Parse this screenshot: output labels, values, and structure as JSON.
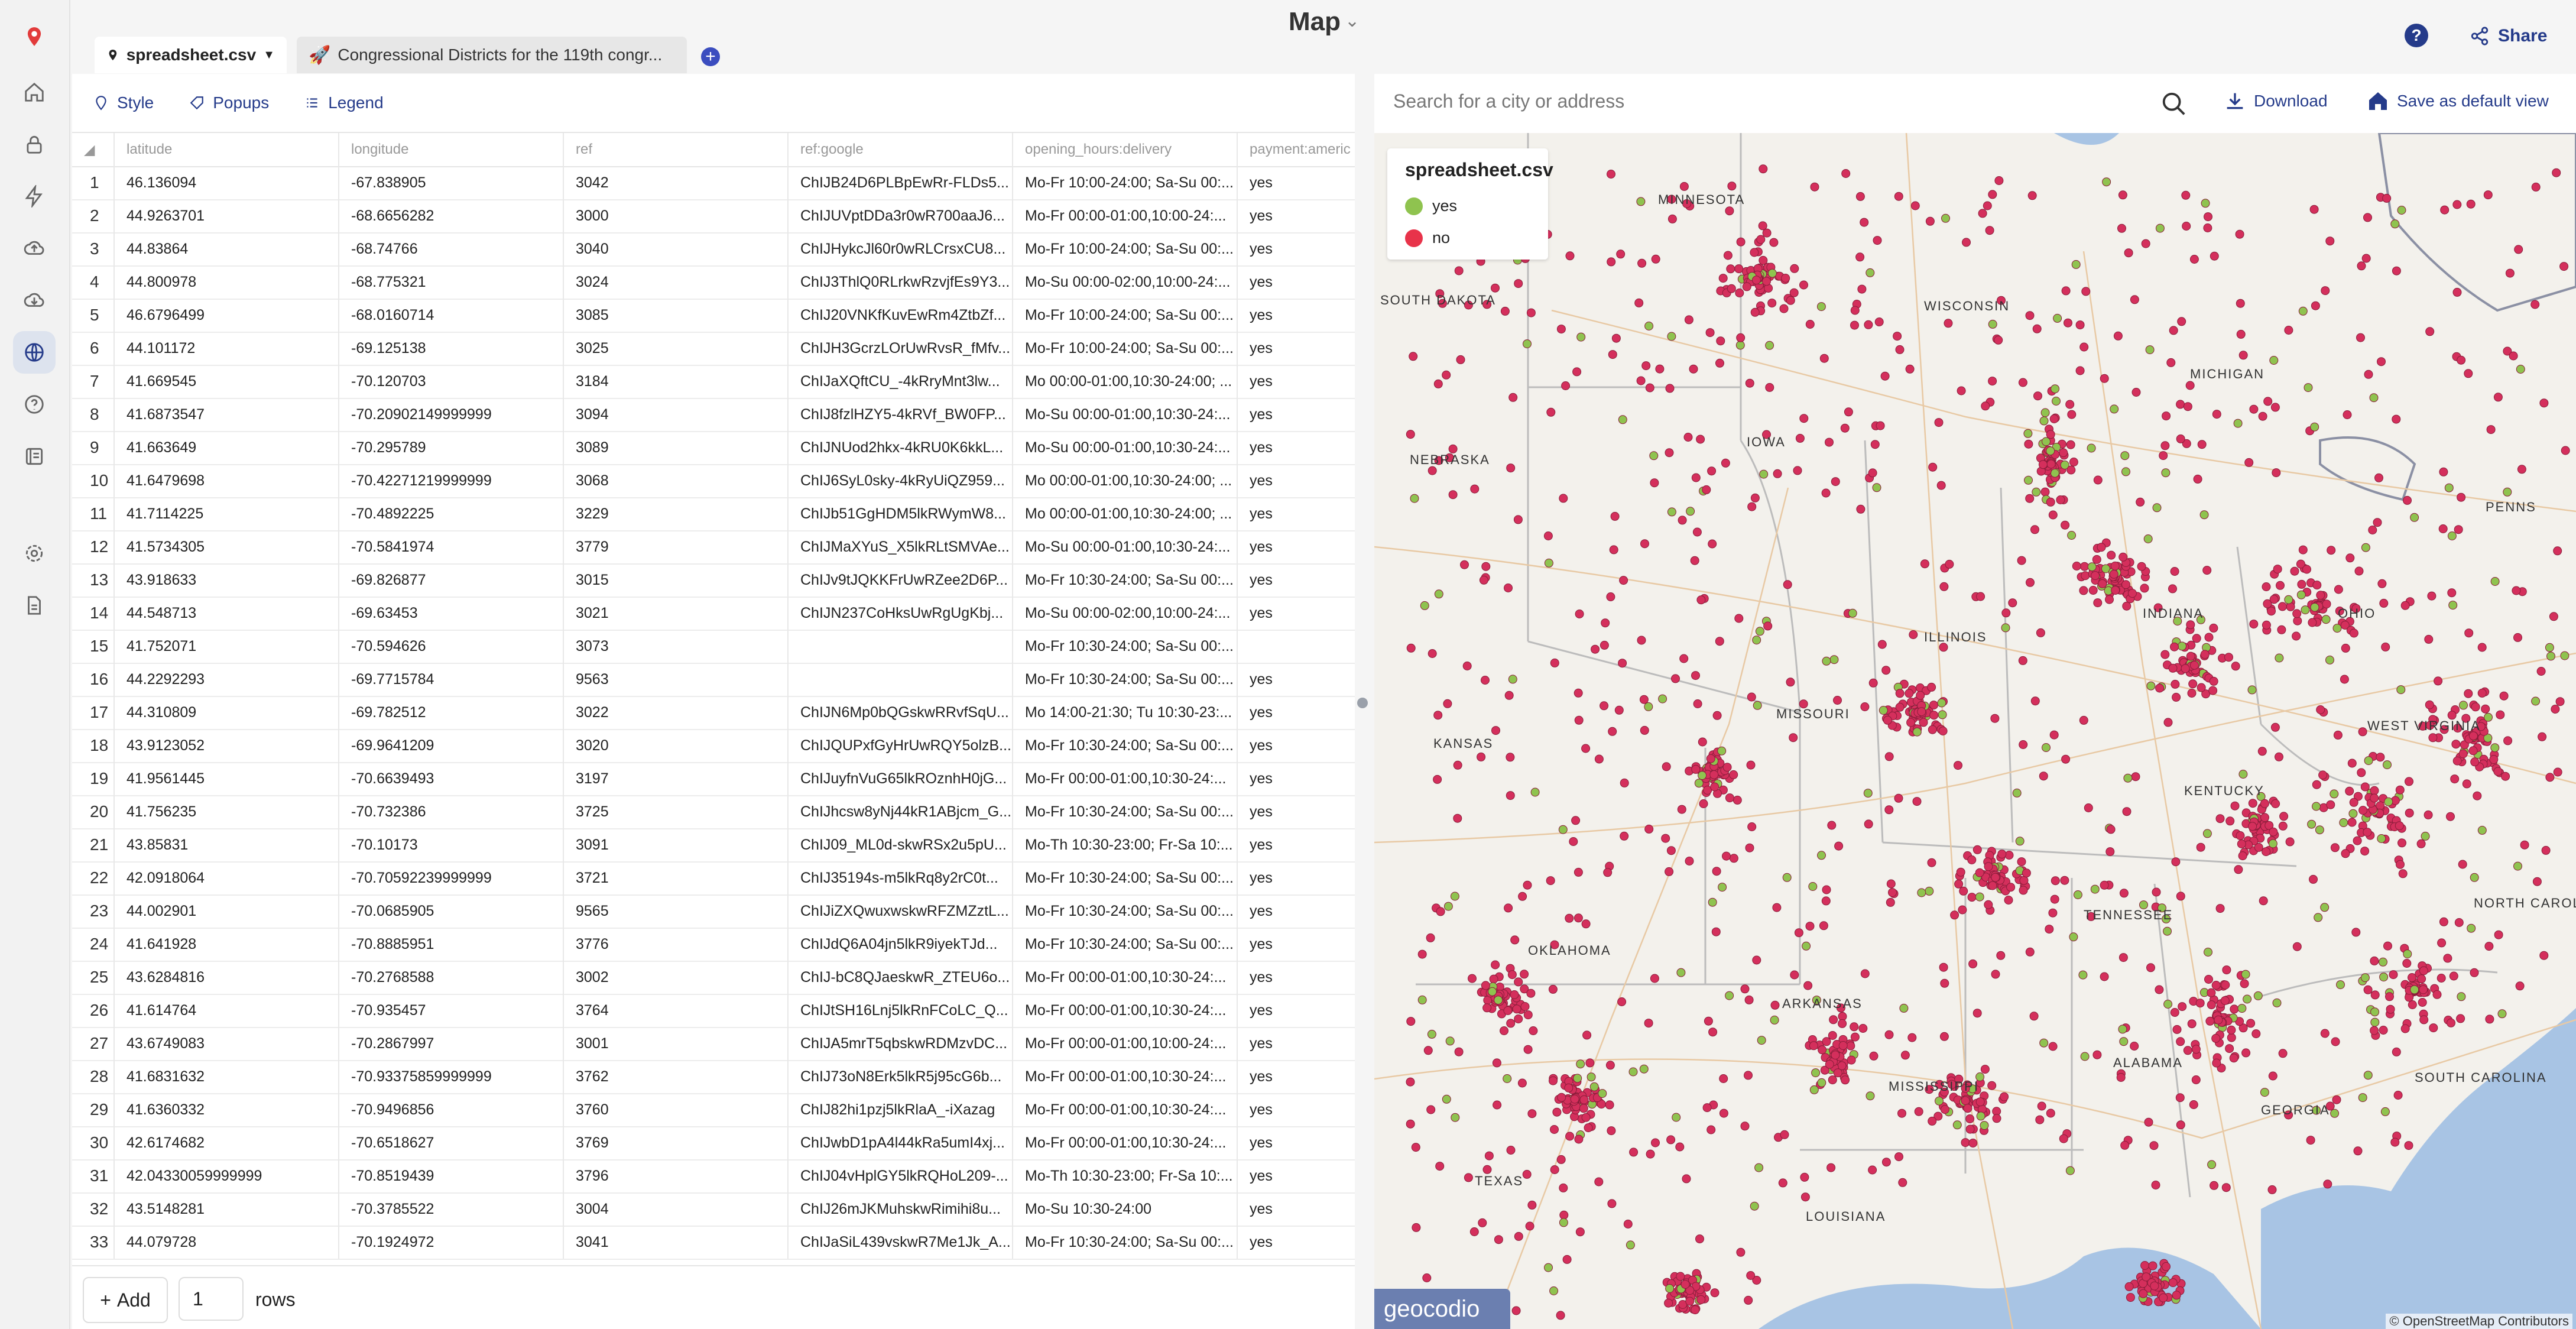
{
  "app": {
    "title": "Map"
  },
  "sidebar": {
    "items": [
      {
        "icon": "logo-pin-icon"
      },
      {
        "icon": "home-icon"
      },
      {
        "icon": "lock-icon"
      },
      {
        "icon": "bolt-icon"
      },
      {
        "icon": "cloud-upload-icon"
      },
      {
        "icon": "cloud-download-icon"
      },
      {
        "icon": "globe-icon",
        "active": true
      },
      {
        "icon": "help-circle-icon"
      },
      {
        "icon": "docs-icon"
      },
      {
        "icon": "settings-icon"
      },
      {
        "icon": "file-icon"
      }
    ]
  },
  "header": {
    "share_label": "Share",
    "help_label": "?"
  },
  "tabs": [
    {
      "label": "spreadsheet.csv",
      "icon": "pin-icon"
    },
    {
      "label": "Congressional Districts for the 119th congr...",
      "icon": "rocket-icon"
    }
  ],
  "toolbar": {
    "style_label": "Style",
    "popups_label": "Popups",
    "legend_label": "Legend"
  },
  "table": {
    "columns": [
      "latitude",
      "longitude",
      "ref",
      "ref:google",
      "opening_hours:delivery",
      "payment:americ"
    ],
    "rows": [
      [
        "1",
        "46.136094",
        "-67.838905",
        "3042",
        "ChIJB24D6PLBpEwRr-FLDs5...",
        "Mo-Fr 10:00-24:00; Sa-Su 00:...",
        "yes"
      ],
      [
        "2",
        "44.9263701",
        "-68.6656282",
        "3000",
        "ChIJUVptDDa3r0wR700aaJ6...",
        "Mo-Fr 00:00-01:00,10:00-24:...",
        "yes"
      ],
      [
        "3",
        "44.83864",
        "-68.74766",
        "3040",
        "ChIJHykcJl60r0wRLCrsxCU8...",
        "Mo-Fr 10:00-24:00; Sa-Su 00:...",
        "yes"
      ],
      [
        "4",
        "44.800978",
        "-68.775321",
        "3024",
        "ChIJ3ThlQ0RLrkwRzvjfEs9Y3...",
        "Mo-Su 00:00-02:00,10:00-24:...",
        "yes"
      ],
      [
        "5",
        "46.6796499",
        "-68.0160714",
        "3085",
        "ChIJ20VNKfKuvEwRm4ZtbZf...",
        "Mo-Fr 10:00-24:00; Sa-Su 00:...",
        "yes"
      ],
      [
        "6",
        "44.101172",
        "-69.125138",
        "3025",
        "ChIJH3GcrzLOrUwRvsR_fMfv...",
        "Mo-Fr 10:00-24:00; Sa-Su 00:...",
        "yes"
      ],
      [
        "7",
        "41.669545",
        "-70.120703",
        "3184",
        "ChIJaXQftCU_-4kRryMnt3lw...",
        "Mo 00:00-01:00,10:30-24:00; ...",
        "yes"
      ],
      [
        "8",
        "41.6873547",
        "-70.20902149999999",
        "3094",
        "ChIJ8fzlHZY5-4kRVf_BW0FP...",
        "Mo-Su 00:00-01:00,10:30-24:...",
        "yes"
      ],
      [
        "9",
        "41.663649",
        "-70.295789",
        "3089",
        "ChIJNUod2hkx-4kRU0K6kkL...",
        "Mo-Su 00:00-01:00,10:30-24:...",
        "yes"
      ],
      [
        "10",
        "41.6479698",
        "-70.42271219999999",
        "3068",
        "ChIJ6SyL0sky-4kRyUiQZ959...",
        "Mo 00:00-01:00,10:30-24:00; ...",
        "yes"
      ],
      [
        "11",
        "41.7114225",
        "-70.4892225",
        "3229",
        "ChIJb51GgHDM5lkRWymW8...",
        "Mo 00:00-01:00,10:30-24:00; ...",
        "yes"
      ],
      [
        "12",
        "41.5734305",
        "-70.5841974",
        "3779",
        "ChIJMaXYuS_X5lkRLtSMVAe...",
        "Mo-Su 00:00-01:00,10:30-24:...",
        "yes"
      ],
      [
        "13",
        "43.918633",
        "-69.826877",
        "3015",
        "ChIJv9tJQKKFrUwRZee2D6P...",
        "Mo-Fr 10:30-24:00; Sa-Su 00:...",
        "yes"
      ],
      [
        "14",
        "44.548713",
        "-69.63453",
        "3021",
        "ChIJN237CoHksUwRgUgKbj...",
        "Mo-Su 00:00-02:00,10:00-24:...",
        "yes"
      ],
      [
        "15",
        "41.752071",
        "-70.594626",
        "3073",
        "",
        "Mo-Fr 10:30-24:00; Sa-Su 00:...",
        ""
      ],
      [
        "16",
        "44.2292293",
        "-69.7715784",
        "9563",
        "",
        "Mo-Fr 10:30-24:00; Sa-Su 00:...",
        "yes"
      ],
      [
        "17",
        "44.310809",
        "-69.782512",
        "3022",
        "ChIJN6Mp0bQGskwRRvfSqU...",
        "Mo 14:00-21:30; Tu 10:30-23:...",
        "yes"
      ],
      [
        "18",
        "43.9123052",
        "-69.9641209",
        "3020",
        "ChIJQUPxfGyHrUwRQY5olzB...",
        "Mo-Fr 10:30-24:00; Sa-Su 00:...",
        "yes"
      ],
      [
        "19",
        "41.9561445",
        "-70.6639493",
        "3197",
        "ChIJuyfnVuG65lkROznhH0jG...",
        "Mo-Fr 00:00-01:00,10:30-24:...",
        "yes"
      ],
      [
        "20",
        "41.756235",
        "-70.732386",
        "3725",
        "ChIJhcsw8yNj44kR1ABjcm_G...",
        "Mo-Fr 10:30-24:00; Sa-Su 00:...",
        "yes"
      ],
      [
        "21",
        "43.85831",
        "-70.10173",
        "3091",
        "ChIJ09_ML0d-skwRSx2u5pU...",
        "Mo-Th 10:30-23:00; Fr-Sa 10:...",
        "yes"
      ],
      [
        "22",
        "42.0918064",
        "-70.70592239999999",
        "3721",
        "ChIJ35194s-m5lkRq8y2rC0t...",
        "Mo-Fr 10:30-24:00; Sa-Su 00:...",
        "yes"
      ],
      [
        "23",
        "44.002901",
        "-70.0685905",
        "9565",
        "ChIJiZXQwuxwskwRFZMZztL...",
        "Mo-Fr 10:30-24:00; Sa-Su 00:...",
        "yes"
      ],
      [
        "24",
        "41.641928",
        "-70.8885951",
        "3776",
        "ChIJdQ6A04jn5lkR9iyekTJd...",
        "Mo-Fr 10:30-24:00; Sa-Su 00:...",
        "yes"
      ],
      [
        "25",
        "43.6284816",
        "-70.2768588",
        "3002",
        "ChIJ-bC8QJaeskwR_ZTEU6o...",
        "Mo-Fr 00:00-01:00,10:30-24:...",
        "yes"
      ],
      [
        "26",
        "41.614764",
        "-70.935457",
        "3764",
        "ChIJtSH16Lnj5lkRnFCoLC_Q...",
        "Mo-Fr 00:00-01:00,10:30-24:...",
        "yes"
      ],
      [
        "27",
        "43.6749083",
        "-70.2867997",
        "3001",
        "ChIJA5mrT5qbskwRDMzvDC...",
        "Mo-Fr 00:00-01:00,10:00-24:...",
        "yes"
      ],
      [
        "28",
        "41.6831632",
        "-70.93375859999999",
        "3762",
        "ChIJ73oN8Erk5lkR5j95cG6b...",
        "Mo-Fr 00:00-01:00,10:30-24:...",
        "yes"
      ],
      [
        "29",
        "41.6360332",
        "-70.9496856",
        "3760",
        "ChIJ82hi1pzj5lkRlaA_-iXazag",
        "Mo-Fr 00:00-01:00,10:30-24:...",
        "yes"
      ],
      [
        "30",
        "42.6174682",
        "-70.6518627",
        "3769",
        "ChIJwbD1pA4l44kRa5umI4xj...",
        "Mo-Fr 00:00-01:00,10:30-24:...",
        "yes"
      ],
      [
        "31",
        "42.04330059999999",
        "-70.8519439",
        "3796",
        "ChIJ04vHplGY5lkRQHoL209-...",
        "Mo-Th 10:30-23:00; Fr-Sa 10:...",
        "yes"
      ],
      [
        "32",
        "43.5148281",
        "-70.3785522",
        "3004",
        "ChIJ26mJKMuhskwRimihi8u...",
        "Mo-Su 10:30-24:00",
        "yes"
      ],
      [
        "33",
        "44.079728",
        "-70.1924972",
        "3041",
        "ChIJaSiL439vskwR7Me1Jk_A...",
        "Mo-Fr 10:30-24:00; Sa-Su 00:...",
        "yes"
      ]
    ]
  },
  "footer": {
    "add_label": "Add",
    "rows_value": "1",
    "rows_label": "rows"
  },
  "map": {
    "search_placeholder": "Search for a city or address",
    "download_label": "Download",
    "save_default_label": "Save as default view",
    "legend": {
      "title": "spreadsheet.csv",
      "items": [
        {
          "label": "yes",
          "color": "#8fc34f"
        },
        {
          "label": "no",
          "color": "#e8334a"
        }
      ]
    },
    "labels": [
      "MINNESOTA",
      "SOUTH DAKOTA",
      "WISCONSIN",
      "MICHIGAN",
      "NEBRASKA",
      "IOWA",
      "ILLINOIS",
      "INDIANA",
      "OHIO",
      "PENNS",
      "KANSAS",
      "MISSOURI",
      "WEST VIRGINIA",
      "KENTUCKY",
      "TENNESSEE",
      "NORTH CAROLI",
      "OKLAHOMA",
      "ARKANSAS",
      "SOUTH CAROLINA",
      "MISSISSIPPI",
      "ALABAMA",
      "GEORGIA",
      "TEXAS",
      "LOUISIANA"
    ],
    "attribution": "© OpenStreetMap Contributors",
    "brand": "geocodio",
    "colors": {
      "point": "#d42f5c",
      "point_green": "#8fc34f",
      "water": "#a8c4e4",
      "land": "#f3f1ec"
    }
  }
}
